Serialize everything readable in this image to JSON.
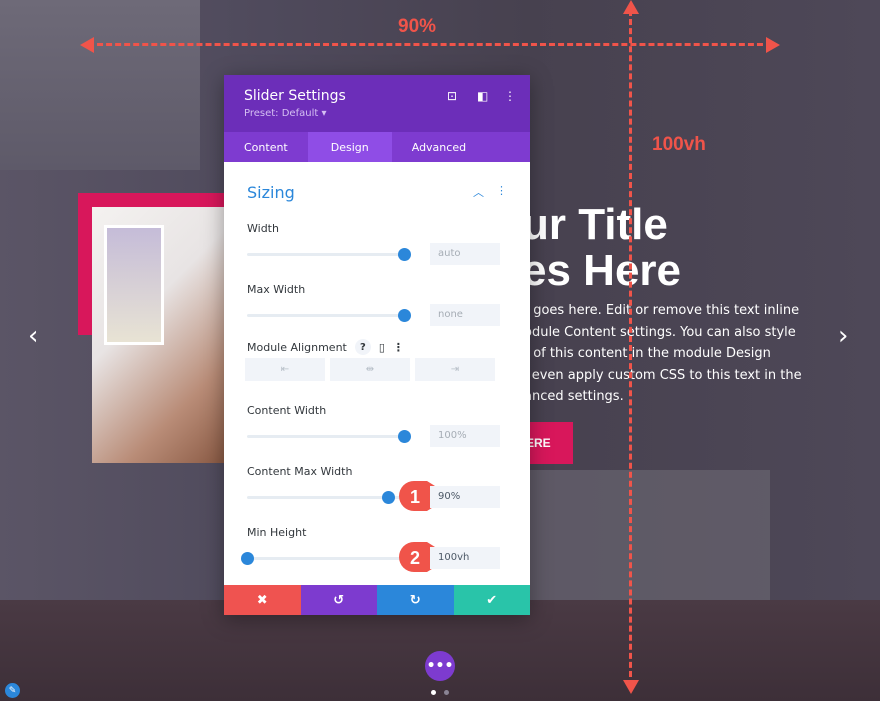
{
  "annotations": {
    "width_label": "90%",
    "height_label": "100vh",
    "color": "#f0544a",
    "badges": [
      "1",
      "2"
    ]
  },
  "hero": {
    "title_lines": [
      "ur Title",
      "es Here"
    ],
    "body_lines": [
      "t goes here. Edit or remove this text inline",
      "odule Content settings. You can also style",
      "t of this content in the module Design",
      "l even apply custom CSS to this text in the",
      "anced settings."
    ],
    "button": "ERE",
    "accent": "#d8175b"
  },
  "panel": {
    "title": "Slider Settings",
    "preset": "Preset: Default ▾",
    "tabs": [
      {
        "label": "Content"
      },
      {
        "label": "Design",
        "active": true
      },
      {
        "label": "Advanced"
      }
    ],
    "section": "Sizing",
    "fields": [
      {
        "label": "Width",
        "value": "auto",
        "slider": 1.0
      },
      {
        "label": "Max Width",
        "value": "none",
        "slider": 1.0
      },
      {
        "label": "Content Width",
        "value": "100%",
        "slider": 1.0
      },
      {
        "label": "Content Max Width",
        "value": "90%",
        "slider": 0.9
      },
      {
        "label": "Min Height",
        "value": "100vh",
        "slider": 0.0
      }
    ],
    "alignment_label": "Module Alignment",
    "alignment_help": "?",
    "footer": {
      "cancel": "✖",
      "undo": "↺",
      "redo": "↻",
      "save": "✔"
    },
    "colors": {
      "header": "#6c2eb9",
      "tabs": "#7e3bd0",
      "accent": "#2b87da",
      "cancel": "#ef5350",
      "undo": "#7d3bcf",
      "redo": "#2b87da",
      "save": "#29c4a9"
    }
  },
  "controls": {
    "prev": "‹",
    "next": "›",
    "more": "•••"
  }
}
